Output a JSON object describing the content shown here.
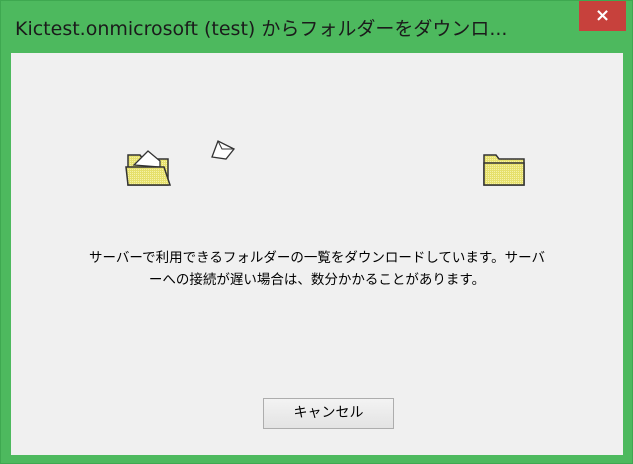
{
  "window": {
    "title": "Kictest.onmicrosoft (test) からフォルダーをダウンロ...",
    "close_label": "×"
  },
  "message": {
    "line1": "サーバーで利用できるフォルダーの一覧をダウンロードしています。サーバ",
    "line2": "ーへの接続が遅い場合は、数分かかることがあります。"
  },
  "buttons": {
    "cancel_label": "キャンセル"
  },
  "icons": {
    "source": "open-folder-icon",
    "destination": "folder-icon",
    "flying": "paper-icon"
  },
  "colors": {
    "frame": "#4db95e",
    "close": "#c7413c",
    "client": "#f0f0f0",
    "folder_fill": "#e8e27a"
  }
}
